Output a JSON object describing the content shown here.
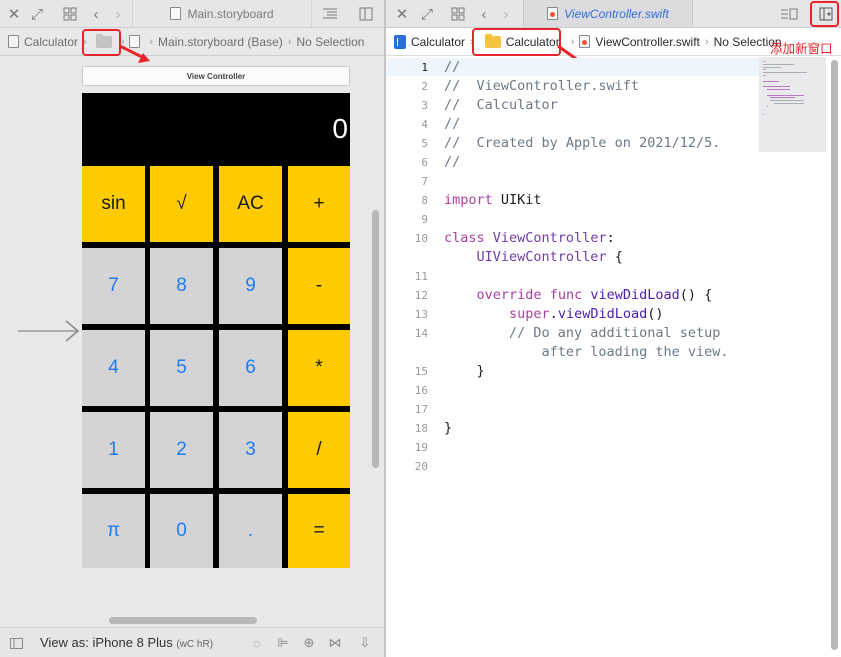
{
  "left_pane": {
    "tab_title": "Main.storyboard",
    "jumpbar": {
      "project": "Calculator",
      "file": "Main.storyboard (Base)",
      "selection": "No Selection"
    },
    "scene_title": "View Controller",
    "calculator": {
      "display_value": "0",
      "keys": [
        [
          "sin",
          "√",
          "AC",
          "+"
        ],
        [
          "7",
          "8",
          "9",
          "-"
        ],
        [
          "4",
          "5",
          "6",
          "*"
        ],
        [
          "1",
          "2",
          "3",
          "/"
        ],
        [
          "π",
          "0",
          ".",
          "="
        ]
      ]
    },
    "bottom_bar": {
      "view_as_label": "View as: iPhone 8 Plus",
      "size_class": "(wC hR)"
    }
  },
  "right_pane": {
    "tab_title": "ViewController.swift",
    "jumpbar": {
      "project": "Calculator",
      "group": "Calculator",
      "file": "ViewController.swift",
      "selection": "No Selection"
    },
    "code_lines": [
      {
        "num": "1",
        "text": "//"
      },
      {
        "num": "2",
        "text": "//  ViewController.swift"
      },
      {
        "num": "3",
        "text": "//  Calculator"
      },
      {
        "num": "4",
        "text": "//"
      },
      {
        "num": "5",
        "text": "//  Created by Apple on 2021/12/5."
      },
      {
        "num": "6",
        "text": "//"
      },
      {
        "num": "7",
        "text": ""
      },
      {
        "num": "8",
        "text": "import UIKit"
      },
      {
        "num": "9",
        "text": ""
      },
      {
        "num": "10",
        "text": "class ViewController:"
      },
      {
        "num": "",
        "text": "    UIViewController {"
      },
      {
        "num": "11",
        "text": ""
      },
      {
        "num": "12",
        "text": "    override func viewDidLoad() {"
      },
      {
        "num": "13",
        "text": "        super.viewDidLoad()"
      },
      {
        "num": "14",
        "text": "        // Do any additional setup"
      },
      {
        "num": "",
        "text": "            after loading the view."
      },
      {
        "num": "15",
        "text": "    }"
      },
      {
        "num": "16",
        "text": ""
      },
      {
        "num": "17",
        "text": ""
      },
      {
        "num": "18",
        "text": "}"
      },
      {
        "num": "19",
        "text": ""
      },
      {
        "num": "20",
        "text": ""
      }
    ]
  },
  "annotation": {
    "text": "添加新窗口",
    "color": "#e8252b"
  },
  "colors": {
    "key_yellow": "#fecb00",
    "key_gray": "#d4d4d6",
    "key_blue_text": "#1c7cf0",
    "highlight_red": "#e8252b"
  }
}
